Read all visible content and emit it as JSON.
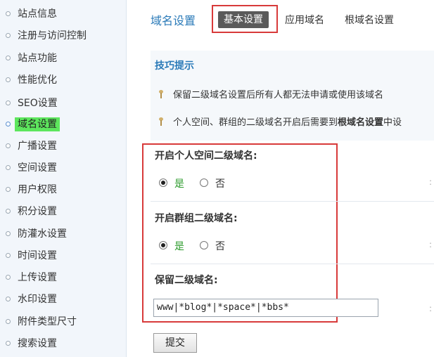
{
  "sidebar": {
    "items": [
      {
        "label": "站点信息",
        "active": false
      },
      {
        "label": "注册与访问控制",
        "active": false
      },
      {
        "label": "站点功能",
        "active": false
      },
      {
        "label": "性能优化",
        "active": false
      },
      {
        "label": "SEO设置",
        "active": false
      },
      {
        "label": "域名设置",
        "active": true
      },
      {
        "label": "广播设置",
        "active": false
      },
      {
        "label": "空间设置",
        "active": false
      },
      {
        "label": "用户权限",
        "active": false
      },
      {
        "label": "积分设置",
        "active": false
      },
      {
        "label": "防灌水设置",
        "active": false
      },
      {
        "label": "时间设置",
        "active": false
      },
      {
        "label": "上传设置",
        "active": false
      },
      {
        "label": "水印设置",
        "active": false
      },
      {
        "label": "附件类型尺寸",
        "active": false
      },
      {
        "label": "搜索设置",
        "active": false
      }
    ],
    "active_color": "#5de65d"
  },
  "header": {
    "title": "域名设置",
    "tabs": [
      {
        "label": "基本设置",
        "active": true
      },
      {
        "label": "应用域名",
        "active": false
      },
      {
        "label": "根域名设置",
        "active": false
      }
    ]
  },
  "tips": {
    "title": "技巧提示",
    "lines": [
      {
        "text": "保留二级域名设置后所有人都无法申请或使用该域名"
      },
      {
        "before": "个人空间、群组的二级域名开启后需要到",
        "bold": "根域名设置",
        "after": "中设"
      }
    ]
  },
  "form": {
    "personal_space": {
      "label": "开启个人空间二级域名:",
      "yes": "是",
      "no": "否",
      "selected": "yes"
    },
    "group": {
      "label": "开启群组二级域名:",
      "yes": "是",
      "no": "否",
      "selected": "yes"
    },
    "reserved": {
      "label": "保留二级域名:",
      "value": "www|*blog*|*space*|*bbs*"
    },
    "submit_label": "提交"
  },
  "colors": {
    "accent": "#2a7ab8",
    "highlight_frame": "#d83a3a",
    "yes_text": "#2a9a2a"
  }
}
